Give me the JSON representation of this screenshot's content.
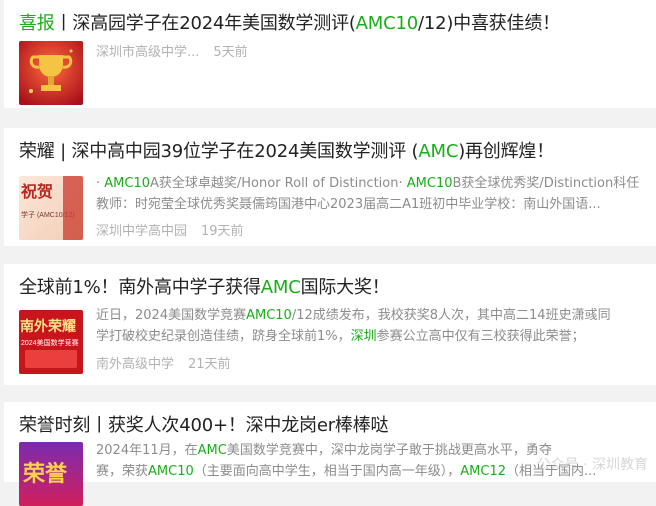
{
  "results": [
    {
      "title_parts": [
        {
          "t": "喜报",
          "hl": true
        },
        {
          "t": "丨深高园学子在2024年美国数学测评(",
          "hl": false
        },
        {
          "t": "AMC10",
          "hl": true
        },
        {
          "t": "/12)中喜获佳绩！",
          "hl": false
        }
      ],
      "snippet_lines": [],
      "source": "深圳市高级中学...",
      "time": "5天前",
      "thumb": "trophy"
    },
    {
      "title_parts": [
        {
          "t": "荣耀 | 深中高中园39位学子在2024美国数学测评 (",
          "hl": false
        },
        {
          "t": "AMC",
          "hl": true
        },
        {
          "t": ")再创辉煌！",
          "hl": false
        }
      ],
      "snippet_lines": [
        [
          {
            "t": "· ",
            "hl": false
          },
          {
            "t": "AMC10",
            "hl": true
          },
          {
            "t": "A获全球卓越奖/Honor Roll of Distinction· ",
            "hl": false
          },
          {
            "t": "AMC10",
            "hl": true
          },
          {
            "t": "B获全球优秀奖/Distinction科任",
            "hl": false
          }
        ],
        [
          {
            "t": "教师：时宛莹全球优秀奖聂儒筠国港中心2023届高二A1班初中毕业学校：南山外国语...",
            "hl": false
          }
        ]
      ],
      "source": "深圳中学高中园",
      "time": "19天前",
      "thumb": "congrats",
      "thumb_text": "祝贺",
      "thumb_sub": "学子  (AMC10/12)"
    },
    {
      "title_parts": [
        {
          "t": "全球前1%！南外高中学子获得",
          "hl": false
        },
        {
          "t": "AMC",
          "hl": true
        },
        {
          "t": "国际大奖！",
          "hl": false
        }
      ],
      "snippet_lines": [
        [
          {
            "t": "近日，2024美国数学竞赛",
            "hl": false
          },
          {
            "t": "AMC10",
            "hl": true
          },
          {
            "t": "/12成绩发布，我校获奖8人次，其中高二14班史潇彧同",
            "hl": false
          }
        ],
        [
          {
            "t": "学打破校史纪录创造佳绩，跻身全球前1%，",
            "hl": false
          },
          {
            "t": "深圳",
            "hl": true
          },
          {
            "t": "参赛公立高中仅有三校获得此荣誉；",
            "hl": false
          }
        ]
      ],
      "source": "南外高级中学",
      "time": "21天前",
      "thumb": "red",
      "thumb_text": "南外荣耀",
      "thumb_sub": "2024美国数学竞赛"
    },
    {
      "title_parts": [
        {
          "t": "荣誉时刻丨获奖人次400+！深中龙岗er棒棒哒",
          "hl": false
        }
      ],
      "snippet_lines": [
        [
          {
            "t": "2024年11月，在",
            "hl": false
          },
          {
            "t": "AMC",
            "hl": true
          },
          {
            "t": "美国数学竞赛中，深中龙岗学子敢于挑战更高水平，勇夺",
            "hl": false
          }
        ],
        [
          {
            "t": "赛，荣获",
            "hl": false
          },
          {
            "t": "AMC10",
            "hl": true
          },
          {
            "t": "（主要面向高中学生，相当于国内高一年级），",
            "hl": false
          },
          {
            "t": "AMC12",
            "hl": true
          },
          {
            "t": "（相当于国内...",
            "hl": false
          }
        ]
      ],
      "source": "",
      "time": "",
      "thumb": "honor",
      "thumb_text": "荣誉"
    }
  ],
  "watermark": "公众号 · 深圳教育"
}
